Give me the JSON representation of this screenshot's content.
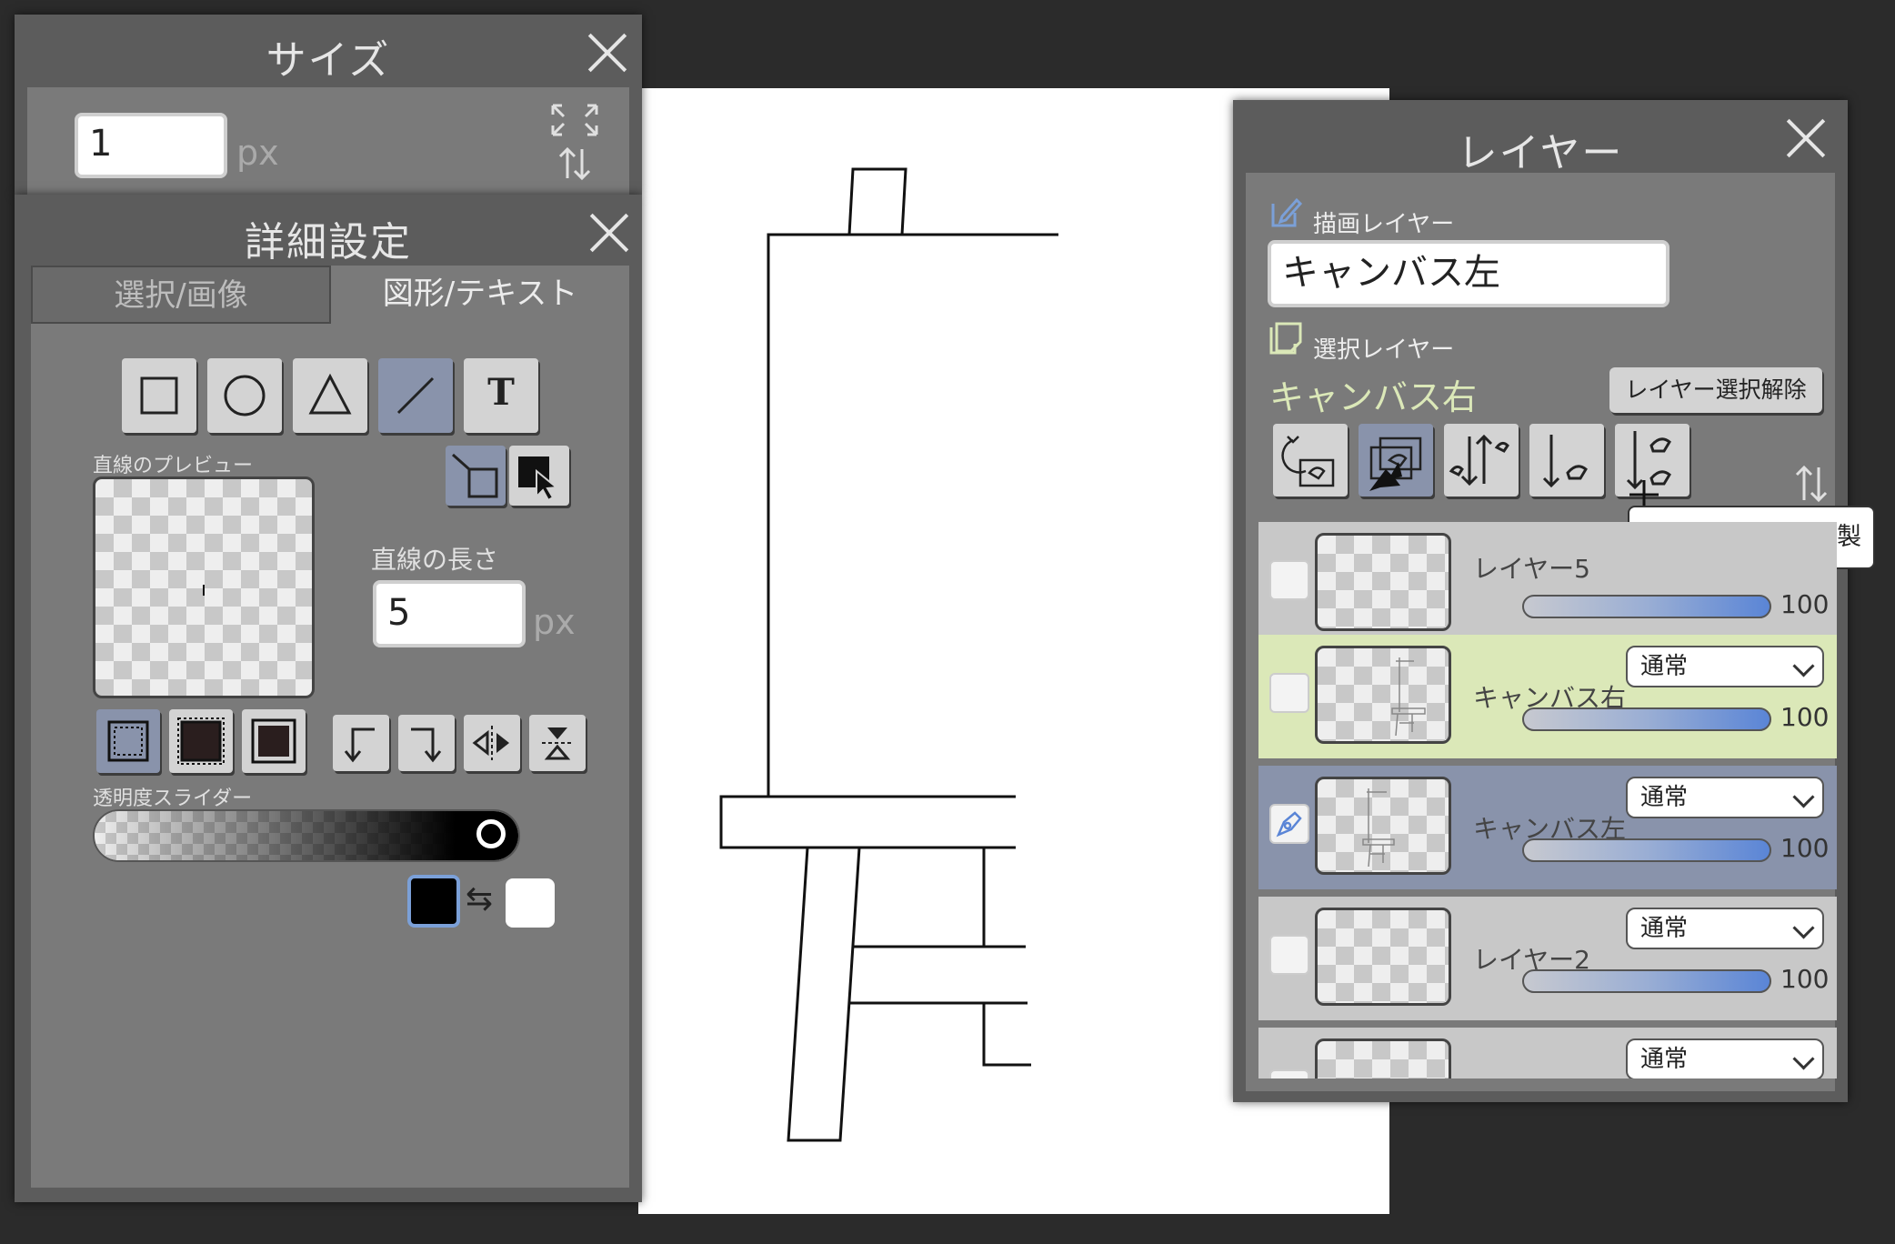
{
  "size_panel": {
    "title": "サイズ",
    "value": "1",
    "unit": "px"
  },
  "detail_panel": {
    "title": "詳細設定",
    "tabs": [
      {
        "label": "選択/画像",
        "active": false
      },
      {
        "label": "図形/テキスト",
        "active": true
      }
    ],
    "shape_tools": [
      "rectangle",
      "ellipse",
      "triangle",
      "line",
      "text"
    ],
    "active_tool": "line",
    "text_tool_label": "T",
    "preview_label": "直線のプレビュー",
    "length_label": "直線の長さ",
    "length_value": "5",
    "length_unit": "px",
    "opacity_label": "透明度スライダー",
    "opacity_value": 100,
    "primary_color": "#000000",
    "secondary_color": "#ffffff",
    "swap_symbol": "⇆"
  },
  "layer_panel": {
    "title": "レイヤー",
    "drawing_layer_label": "描画レイヤー",
    "drawing_layer_value": "キャンバス左",
    "selection_layer_label": "選択レイヤー",
    "selection_layer_value": "キャンバス右",
    "deselect_button": "レイヤー選択解除",
    "tooltip": "選択レイヤーに複製",
    "accent_color": "#dbe8b8",
    "active_row_color": "#8993ab",
    "layers": [
      {
        "name": "レイヤー5",
        "opacity": "100",
        "blend": "",
        "state": "normal"
      },
      {
        "name": "キャンバス右",
        "opacity": "100",
        "blend": "通常",
        "state": "selected"
      },
      {
        "name": "キャンバス左",
        "opacity": "100",
        "blend": "通常",
        "state": "drawing"
      },
      {
        "name": "レイヤー2",
        "opacity": "100",
        "blend": "通常",
        "state": "normal"
      },
      {
        "name": "",
        "opacity": "",
        "blend": "通常",
        "state": "normal"
      }
    ]
  }
}
